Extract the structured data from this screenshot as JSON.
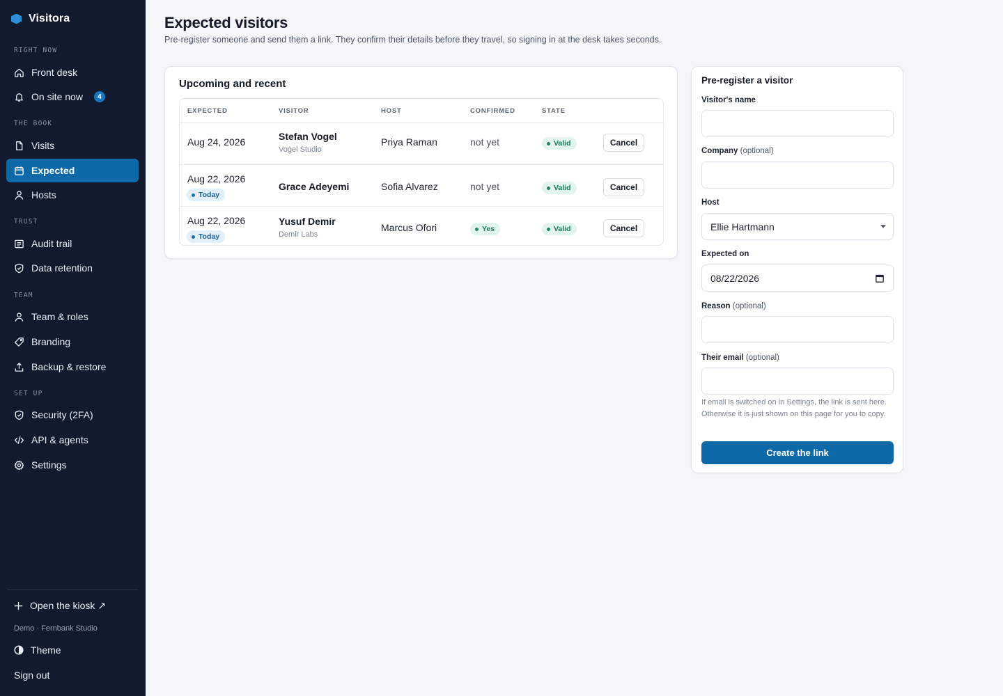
{
  "app": {
    "name": "Visitora"
  },
  "sidebar": {
    "sections": [
      {
        "label": "RIGHT NOW"
      },
      {
        "label": "THE BOOK"
      },
      {
        "label": "TRUST"
      },
      {
        "label": "TEAM"
      },
      {
        "label": "SET UP"
      }
    ],
    "items": [
      {
        "label": "Front desk",
        "icon": "home-icon"
      },
      {
        "label": "On site now",
        "icon": "bell-icon",
        "badge": "4"
      },
      {
        "label": "Visits",
        "icon": "document-icon"
      },
      {
        "label": "Expected",
        "icon": "calendar-icon",
        "active": true
      },
      {
        "label": "Hosts",
        "icon": "user-icon"
      },
      {
        "label": "Audit trail",
        "icon": "list-icon"
      },
      {
        "label": "Data retention",
        "icon": "shield-icon"
      },
      {
        "label": "Team & roles",
        "icon": "user-icon"
      },
      {
        "label": "Branding",
        "icon": "tag-icon"
      },
      {
        "label": "Backup & restore",
        "icon": "upload-icon"
      },
      {
        "label": "Security (2FA)",
        "icon": "shield-icon"
      },
      {
        "label": "API & agents",
        "icon": "code-icon"
      },
      {
        "label": "Settings",
        "icon": "gear-icon"
      }
    ],
    "kiosk_label": "Open the kiosk ↗",
    "demo_text": "Demo · Fernbank Studio",
    "theme_label": "Theme",
    "signout_label": "Sign out"
  },
  "header": {
    "title": "Expected visitors",
    "subtitle": "Pre-register someone and send them a link. They confirm their details before they travel, so signing in at the desk takes seconds."
  },
  "table": {
    "title": "Upcoming and recent",
    "columns": [
      "EXPECTED",
      "VISITOR",
      "HOST",
      "CONFIRMED",
      "STATE"
    ],
    "rows": [
      {
        "date": "Aug 24, 2026",
        "today": "",
        "visitor": "Stefan Vogel",
        "company": "Vogel Studio",
        "host": "Priya Raman",
        "confirmed": "not yet",
        "state": "Valid",
        "action": "Cancel"
      },
      {
        "date": "Aug 22, 2026",
        "today": "Today",
        "visitor": "Grace Adeyemi",
        "company": "",
        "host": "Sofia Alvarez",
        "confirmed": "not yet",
        "state": "Valid",
        "action": "Cancel"
      },
      {
        "date": "Aug 22, 2026",
        "today": "Today",
        "visitor": "Yusuf Demir",
        "company": "Demir Labs",
        "host": "Marcus Ofori",
        "confirmed": "Yes",
        "state": "Valid",
        "action": "Cancel"
      }
    ]
  },
  "form": {
    "title": "Pre-register a visitor",
    "name_label": "Visitor's name",
    "name_value": "",
    "company_label": "Company",
    "company_opt": "(optional)",
    "company_value": "",
    "host_label": "Host",
    "host_value": "Ellie Hartmann",
    "date_label": "Expected on",
    "date_value": "08/22/2026",
    "reason_label": "Reason",
    "reason_opt": "(optional)",
    "reason_value": "",
    "email_label": "Their email",
    "email_opt": "(optional)",
    "email_value": "",
    "help": "If email is switched on in Settings, the link is sent here. Otherwise it is just shown on this page for you to copy.",
    "submit_label": "Create the link"
  },
  "colors": {
    "sidebar_bg": "#121a2e",
    "accent": "#0d69a8",
    "valid_green": "#1b7a5a",
    "today_blue": "#1c5f96"
  }
}
